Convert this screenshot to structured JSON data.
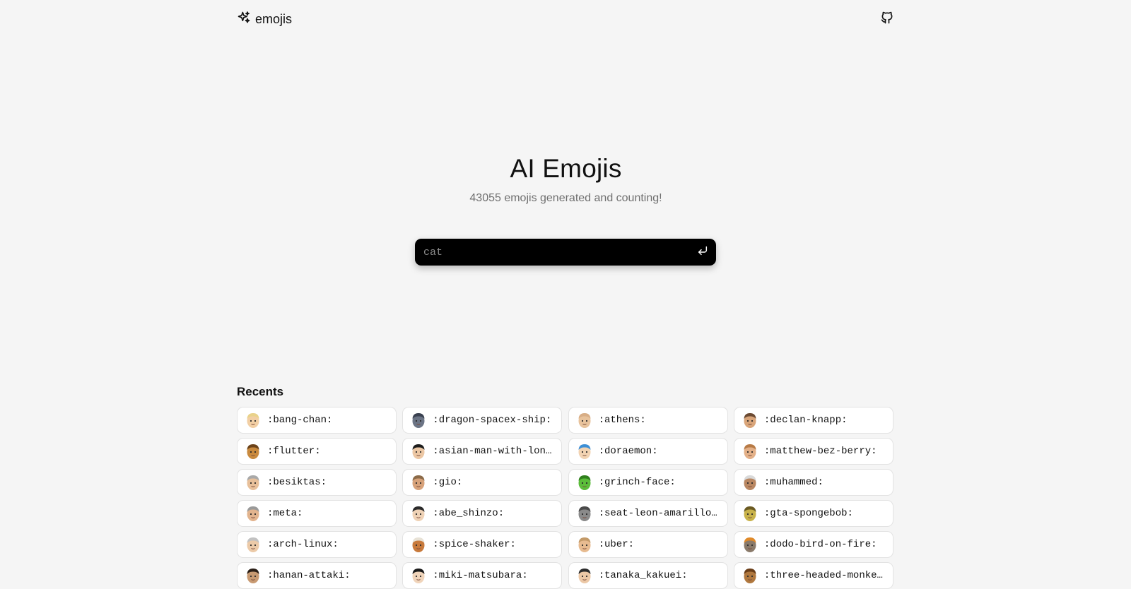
{
  "header": {
    "brand_label": "emojis",
    "brand_icon": "sparkles-icon",
    "github_icon": "github-icon"
  },
  "hero": {
    "title": "AI Emojis",
    "subtitle": "43055 emojis generated and counting!"
  },
  "search": {
    "placeholder": "cat",
    "submit_icon": "enter-return-icon"
  },
  "recents": {
    "title": "Recents",
    "items": [
      {
        "label": ":bang-chan:",
        "skin": "#f2cfa4",
        "hair": "#e9d28a"
      },
      {
        "label": ":dragon-spacex-ship:",
        "skin": "#6b7485",
        "hair": "#3a4150"
      },
      {
        "label": ":athens:",
        "skin": "#e8c39c",
        "hair": "#d8ae86"
      },
      {
        "label": ":declan-knapp:",
        "skin": "#d9a57a",
        "hair": "#6b4a32"
      },
      {
        "label": ":flutter:",
        "skin": "#c98a3e",
        "hair": "#6b4218"
      },
      {
        "label": ":asian-man-with-long-hair:",
        "skin": "#ecc7a4",
        "hair": "#1c1c1c"
      },
      {
        "label": ":doraemon:",
        "skin": "#f2d3b2",
        "hair": "#3d8fd6"
      },
      {
        "label": ":matthew-bez-berry:",
        "skin": "#e3b088",
        "hair": "#b77a45"
      },
      {
        "label": ":besiktas:",
        "skin": "#e8c09a",
        "hair": "#a9a9a9"
      },
      {
        "label": ":gio:",
        "skin": "#d7a27a",
        "hair": "#8b6a48"
      },
      {
        "label": ":grinch-face:",
        "skin": "#5bbd3a",
        "hair": "#2f7f1c"
      },
      {
        "label": ":muhammed:",
        "skin": "#b98762",
        "hair": "#d9d9d9"
      },
      {
        "label": ":meta:",
        "skin": "#e2b48e",
        "hair": "#9a9a9a"
      },
      {
        "label": ":abe_shinzo:",
        "skin": "#efd2b6",
        "hair": "#2a2a2a"
      },
      {
        "label": ":seat-leon-amarillo-bmw-m:",
        "skin": "#8a8a8a",
        "hair": "#4a4a4a"
      },
      {
        "label": ":gta-spongebob:",
        "skin": "#c8b24a",
        "hair": "#6a5a22"
      },
      {
        "label": ":arch-linux:",
        "skin": "#eccaa8",
        "hair": "#c2c2c2"
      },
      {
        "label": ":spice-shaker:",
        "skin": "#c87a3c",
        "hair": "#e8e2d6"
      },
      {
        "label": ":uber:",
        "skin": "#e7bb90",
        "hair": "#c39a68"
      },
      {
        "label": ":dodo-bird-on-fire:",
        "skin": "#8a7a6a",
        "hair": "#e08a2a"
      },
      {
        "label": ":hanan-attaki:",
        "skin": "#c89a72",
        "hair": "#2a1e16"
      },
      {
        "label": ":miki-matsubara:",
        "skin": "#f0d4ba",
        "hair": "#1a1a1a"
      },
      {
        "label": ":tanaka_kakuei:",
        "skin": "#ecc8a6",
        "hair": "#2c2c2c"
      },
      {
        "label": ":three-headed-monkey:",
        "skin": "#b0783e",
        "hair": "#6a3e18"
      }
    ]
  }
}
